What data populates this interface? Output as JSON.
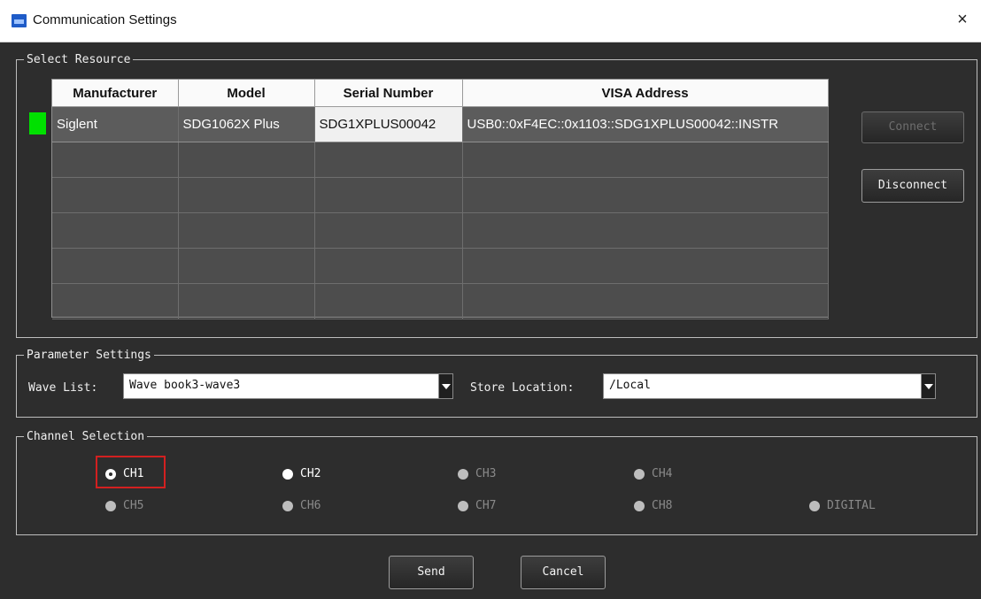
{
  "window": {
    "title": "Communication Settings",
    "close_icon": "×"
  },
  "resource": {
    "legend": "Select Resource",
    "columns": [
      "Manufacturer",
      "Model",
      "Serial Number",
      "VISA Address"
    ],
    "rows": [
      [
        "Siglent",
        "SDG1062X Plus",
        "SDG1XPLUS00042",
        "USB0::0xF4EC::0x1103::SDG1XPLUS00042::INSTR"
      ],
      [
        "",
        "",
        "",
        ""
      ],
      [
        "",
        "",
        "",
        ""
      ],
      [
        "",
        "",
        "",
        ""
      ],
      [
        "",
        "",
        "",
        ""
      ],
      [
        "",
        "",
        "",
        ""
      ]
    ],
    "status_color": "#00e000",
    "connect_label": "Connect",
    "disconnect_label": "Disconnect"
  },
  "params": {
    "legend": "Parameter Settings",
    "wave_list_label": "Wave List:",
    "wave_list_value": "Wave book3-wave3",
    "store_location_label": "Store Location:",
    "store_location_value": "/Local"
  },
  "channels": {
    "legend": "Channel Selection",
    "items": [
      {
        "label": "CH1",
        "enabled": true,
        "selected": true
      },
      {
        "label": "CH2",
        "enabled": true,
        "selected": false
      },
      {
        "label": "CH3",
        "enabled": false,
        "selected": false
      },
      {
        "label": "CH4",
        "enabled": false,
        "selected": false
      },
      {
        "label": "CH5",
        "enabled": false,
        "selected": false
      },
      {
        "label": "CH6",
        "enabled": false,
        "selected": false
      },
      {
        "label": "CH7",
        "enabled": false,
        "selected": false
      },
      {
        "label": "CH8",
        "enabled": false,
        "selected": false
      },
      {
        "label": "DIGITAL",
        "enabled": false,
        "selected": false
      }
    ]
  },
  "footer": {
    "send_label": "Send",
    "cancel_label": "Cancel"
  }
}
